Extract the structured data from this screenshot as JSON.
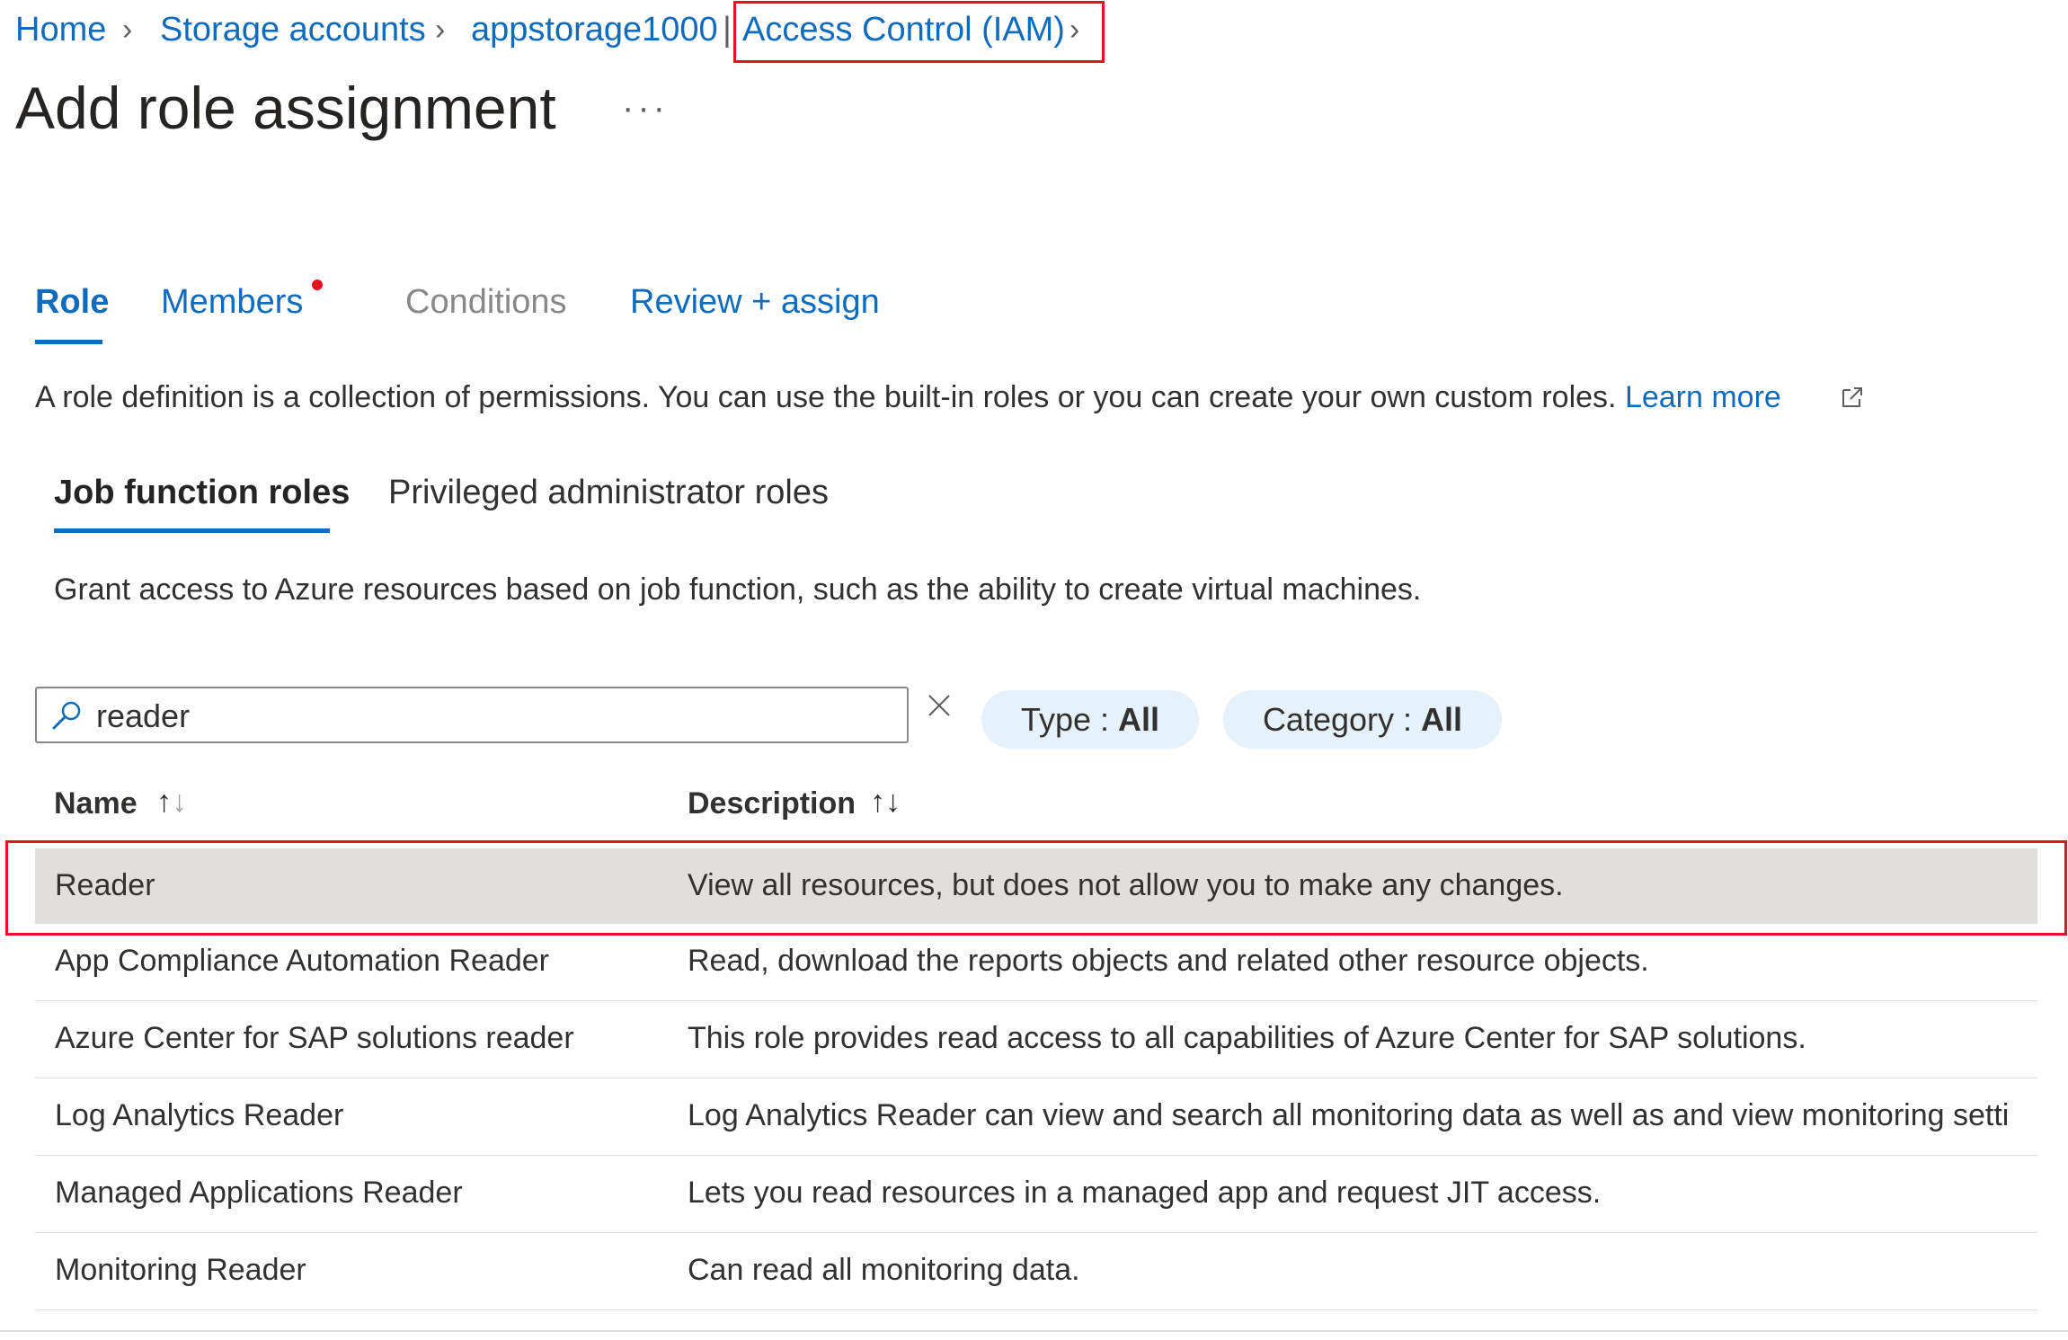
{
  "breadcrumb": {
    "items": [
      "Home",
      "Storage accounts",
      "appstorage1000",
      "Access Control (IAM)"
    ],
    "pipe": "|"
  },
  "page": {
    "title": "Add role assignment",
    "more": "···"
  },
  "tabs": [
    {
      "label": "Role",
      "active": true
    },
    {
      "label": "Members",
      "has_indicator": true
    },
    {
      "label": "Conditions",
      "disabled": true
    },
    {
      "label": "Review + assign"
    }
  ],
  "role_description": {
    "text": "A role definition is a collection of permissions. You can use the built-in roles or you can create your own custom roles.",
    "link": "Learn more"
  },
  "subtabs": [
    {
      "label": "Job function roles",
      "active": true
    },
    {
      "label": "Privileged administrator roles"
    }
  ],
  "job_function_description": "Grant access to Azure resources based on job function, such as the ability to create virtual machines.",
  "search": {
    "value": "reader"
  },
  "filters": [
    {
      "label": "Type : ",
      "value": "All"
    },
    {
      "label": "Category : ",
      "value": "All"
    }
  ],
  "table": {
    "columns": [
      "Name",
      "Description"
    ],
    "rows": [
      {
        "name": "Reader",
        "description": "View all resources, but does not allow you to make any changes.",
        "selected": true
      },
      {
        "name": "App Compliance Automation Reader",
        "description": "Read, download the reports objects and related other resource objects."
      },
      {
        "name": "Azure Center for SAP solutions reader",
        "description": "This role provides read access to all capabilities of Azure Center for SAP solutions."
      },
      {
        "name": "Log Analytics Reader",
        "description": "Log Analytics Reader can view and search all monitoring data as well as and view monitoring setti"
      },
      {
        "name": "Managed Applications Reader",
        "description": "Lets you read resources in a managed app and request JIT access."
      },
      {
        "name": "Monitoring Reader",
        "description": "Can read all monitoring data."
      }
    ]
  },
  "colors": {
    "accent": "#0f6cbd",
    "highlight": "#e81123",
    "selected_row": "#e1dfdd",
    "pill": "#e6f2fb"
  }
}
